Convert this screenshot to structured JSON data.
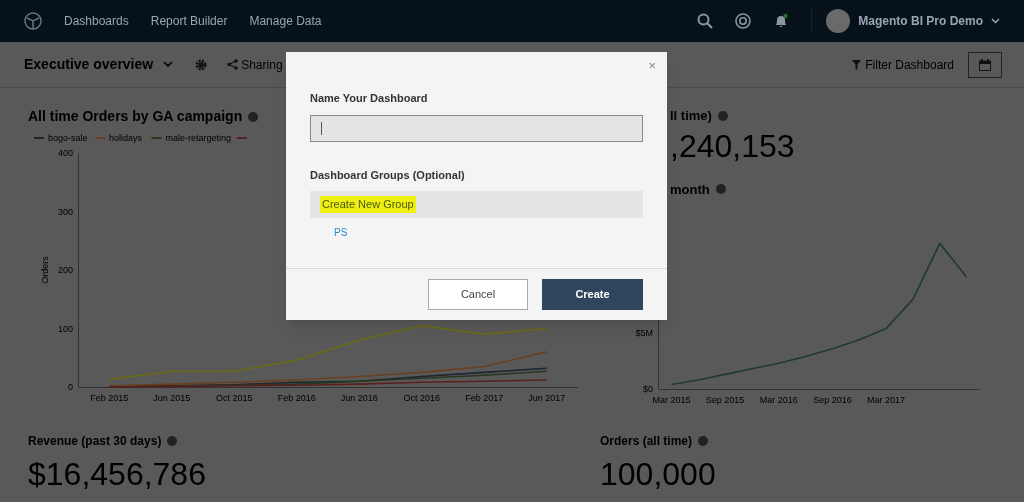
{
  "navbar": {
    "links": [
      "Dashboards",
      "Report Builder",
      "Manage Data"
    ],
    "user": "Magento BI Pro Demo"
  },
  "toolbar": {
    "dashboard_title": "Executive overview",
    "sharing": "Sharing",
    "filter": "Filter Dashboard"
  },
  "left_chart": {
    "title": "All time Orders by GA campaign",
    "chart_data": {
      "type": "line",
      "legend": "top",
      "ylabel": "Orders",
      "categories": [
        "Feb 2015",
        "Jun 2015",
        "Oct 2015",
        "Feb 2016",
        "Jun 2016",
        "Oct 2016",
        "Feb 2017",
        "Jun 2017"
      ],
      "ylim": [
        0,
        400
      ],
      "yticks": [
        0,
        100,
        200,
        300,
        400
      ],
      "series": [
        {
          "name": "bogo-sale",
          "color": "#1d2530",
          "values": [
            1,
            2,
            4,
            8,
            10,
            18,
            25,
            32
          ]
        },
        {
          "name": "holidays",
          "color": "#6a4020",
          "values": [
            2,
            5,
            8,
            12,
            18,
            25,
            35,
            60
          ]
        },
        {
          "name": "male-retargeting",
          "color": "#28381f",
          "values": [
            0,
            1,
            3,
            5,
            10,
            15,
            20,
            27
          ]
        },
        {
          "color": "#5a2020",
          "values": [
            0,
            1,
            2,
            3,
            5,
            8,
            10,
            12
          ]
        },
        {
          "color": "#6a6a18",
          "values": [
            13,
            27,
            27,
            46,
            80,
            105,
            90,
            100
          ]
        }
      ]
    }
  },
  "right_top": {
    "title_fragment": "ll time)",
    "value_fragment": ",240,153"
  },
  "right_chart": {
    "title_fragment": "month",
    "chart_data": {
      "type": "line",
      "categories": [
        "Mar 2015",
        null,
        "Sep 2015",
        null,
        "Mar 2016",
        null,
        "Sep 2016",
        null,
        "Mar 2017",
        null,
        null,
        null
      ],
      "ylim": [
        0,
        15
      ],
      "yticks": [
        {
          "value": 0,
          "label": "$0"
        },
        {
          "value": 5,
          "label": "$5M"
        }
      ],
      "series": [
        {
          "color": "#1f3a30",
          "values": [
            0.4,
            0.8,
            1.3,
            1.8,
            2.3,
            2.9,
            3.6,
            4.4,
            5.4,
            8,
            13,
            10
          ]
        }
      ]
    }
  },
  "bottom_cards": [
    {
      "title": "Revenue (past 30 days)",
      "value": "$16,456,786"
    },
    {
      "title": "Orders (all time)",
      "value": "100,000"
    }
  ],
  "modal": {
    "close": "×",
    "name_label": "Name Your Dashboard",
    "groups_label": "Dashboard Groups (Optional)",
    "groups": [
      {
        "label": "Create New Group",
        "kind": "action",
        "highlighted": true
      },
      {
        "label": "PS",
        "kind": "group",
        "highlighted": false
      }
    ],
    "buttons": [
      {
        "label": "Cancel",
        "kind": "secondary"
      },
      {
        "label": "Create",
        "kind": "primary"
      }
    ]
  }
}
